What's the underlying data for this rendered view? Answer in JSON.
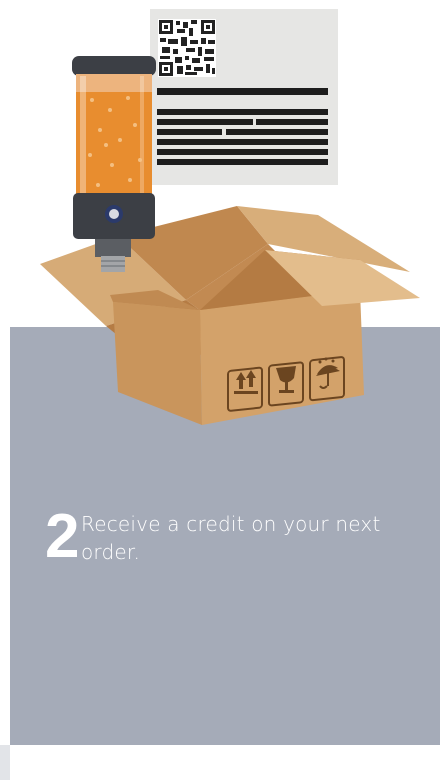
{
  "step": {
    "number": "2",
    "text": "Receive a credit on your next order."
  },
  "colors": {
    "panel": "#a5abb8",
    "box": "#d3a26a",
    "text": "#ffffff"
  },
  "icons": [
    "this-way-up-icon",
    "fragile-icon",
    "keep-dry-icon",
    "qr-code-icon"
  ]
}
